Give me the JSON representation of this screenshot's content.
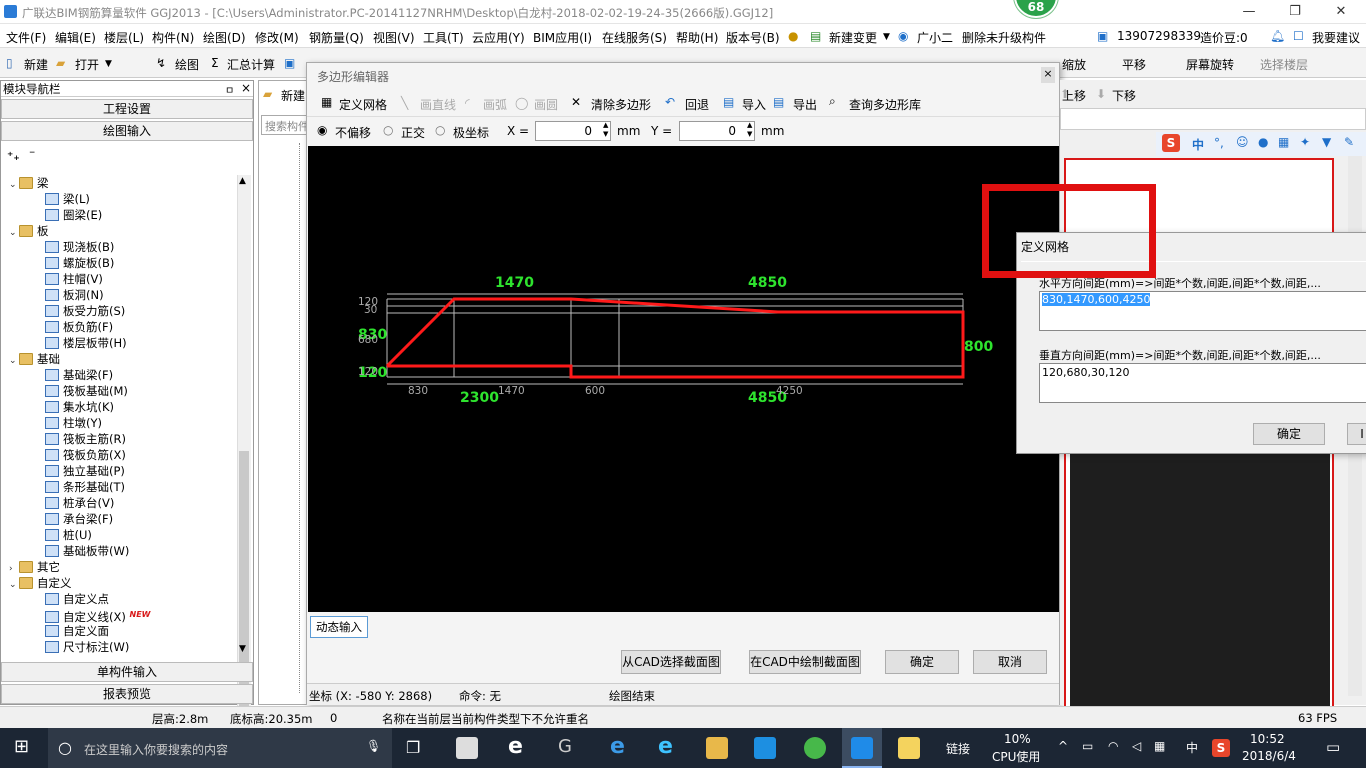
{
  "window": {
    "title": "广联达BIM钢筋算量软件 GGJ2013 - [C:\\Users\\Administrator.PC-20141127NRHM\\Desktop\\白龙村-2018-02-02-19-24-35(2666版).GGJ12]",
    "badge": "68"
  },
  "menu": {
    "items": [
      "文件(F)",
      "编辑(E)",
      "楼层(L)",
      "构件(N)",
      "绘图(D)",
      "修改(M)",
      "钢筋量(Q)",
      "视图(V)",
      "工具(T)",
      "云应用(Y)",
      "BIM应用(I)",
      "在线服务(S)",
      "帮助(H)",
      "版本号(B)"
    ],
    "new_change": "新建变更",
    "guangxiaoer": "广小二",
    "delete_unupgraded": "删除未升级构件",
    "phone": "13907298339",
    "price_beans": "造价豆:0",
    "suggest": "我要建议"
  },
  "toolbar": {
    "new": "新建",
    "open": "打开",
    "draw": "绘图",
    "sum_calc": "汇总计算",
    "zoom": "缩放",
    "pan": "平移",
    "screen_rotate": "屏幕旋转",
    "select_floor": "选择楼层"
  },
  "nav": {
    "title": "模块导航栏",
    "pin": "ㅁ",
    "close": "×",
    "project_settings": "工程设置",
    "drawing_input": "绘图输入",
    "single_input": "单构件输入",
    "report_preview": "报表预览",
    "tree": [
      {
        "label": "梁",
        "folder": true,
        "level": 0
      },
      {
        "label": "梁(L)",
        "level": 1
      },
      {
        "label": "圈梁(E)",
        "level": 1
      },
      {
        "label": "板",
        "folder": true,
        "level": 0
      },
      {
        "label": "现浇板(B)",
        "level": 1
      },
      {
        "label": "螺旋板(B)",
        "level": 1
      },
      {
        "label": "柱帽(V)",
        "level": 1
      },
      {
        "label": "板洞(N)",
        "level": 1
      },
      {
        "label": "板受力筋(S)",
        "level": 1
      },
      {
        "label": "板负筋(F)",
        "level": 1
      },
      {
        "label": "楼层板带(H)",
        "level": 1
      },
      {
        "label": "基础",
        "folder": true,
        "level": 0
      },
      {
        "label": "基础梁(F)",
        "level": 1
      },
      {
        "label": "筏板基础(M)",
        "level": 1
      },
      {
        "label": "集水坑(K)",
        "level": 1
      },
      {
        "label": "柱墩(Y)",
        "level": 1
      },
      {
        "label": "筏板主筋(R)",
        "level": 1
      },
      {
        "label": "筏板负筋(X)",
        "level": 1
      },
      {
        "label": "独立基础(P)",
        "level": 1
      },
      {
        "label": "条形基础(T)",
        "level": 1
      },
      {
        "label": "桩承台(V)",
        "level": 1
      },
      {
        "label": "承台梁(F)",
        "level": 1
      },
      {
        "label": "桩(U)",
        "level": 1
      },
      {
        "label": "基础板带(W)",
        "level": 1
      },
      {
        "label": "其它",
        "folder": true,
        "level": 0,
        "collapsed": true
      },
      {
        "label": "自定义",
        "folder": true,
        "level": 0
      },
      {
        "label": "自定义点",
        "level": 1
      },
      {
        "label": "自定义线(X)",
        "level": 1,
        "new": "NEW"
      },
      {
        "label": "自定义面",
        "level": 1
      },
      {
        "label": "尺寸标注(W)",
        "level": 1
      }
    ]
  },
  "mid": {
    "new": "新建",
    "search": "搜索构件"
  },
  "editor": {
    "title": "多边形编辑器",
    "define_grid": "定义网格",
    "draw_line": "画直线",
    "draw_arc": "画弧",
    "draw_circle": "画圆",
    "clear_polygon": "清除多边形",
    "undo": "回退",
    "import": "导入",
    "export": "导出",
    "query_lib": "查询多边形库",
    "mode_no_offset": "不偏移",
    "mode_ortho": "正交",
    "mode_polar": "极坐标",
    "x_label": "X =",
    "x_value": "0",
    "y_label": "Y =",
    "y_value": "0",
    "unit": "mm",
    "dynamic_input": "动态输入",
    "from_cad": "从CAD选择截面图",
    "draw_in_cad": "在CAD中绘制截面图",
    "ok": "确定",
    "cancel": "取消",
    "coord": "坐标 (X: -580 Y: 2868)",
    "command": "命令: 无",
    "draw_end": "绘图结束",
    "dims": {
      "top1": "1470",
      "top2": "4850",
      "bot1": "2300",
      "bot2": "4850",
      "left_830": "830",
      "left_120": "120",
      "right_800": "800",
      "s_830": "830",
      "s_1470": "1470",
      "s_600": "600",
      "s_4250": "4250",
      "v_120": "120",
      "v_30": "30",
      "v_680": "680",
      "v_120b": "120"
    }
  },
  "grid_dialog": {
    "title": "定义网格",
    "h_label": "水平方向间距(mm)=>间距*个数,间距,间距*个数,间距,...",
    "h_value": "830,1470,600,4250",
    "v_label": "垂直方向间距(mm)=>间距*个数,间距,间距*个数,间距,...",
    "v_value": "120,680,30,120",
    "ok": "确定",
    "cancel_partial": "I"
  },
  "right": {
    "move_up": "上移",
    "move_down": "下移"
  },
  "status": {
    "floor_height": "层高:2.8m",
    "bottom_height": "底标高:20.35m",
    "zero": "0",
    "message": "名称在当前层当前构件类型下不允许重名",
    "fps": "63 FPS"
  },
  "taskbar": {
    "search": "在这里输入你要搜索的内容",
    "link": "链接",
    "cpu_pct": "10%",
    "cpu_label": "CPU使用",
    "ime": "中",
    "time": "10:52",
    "date": "2018/6/4"
  }
}
